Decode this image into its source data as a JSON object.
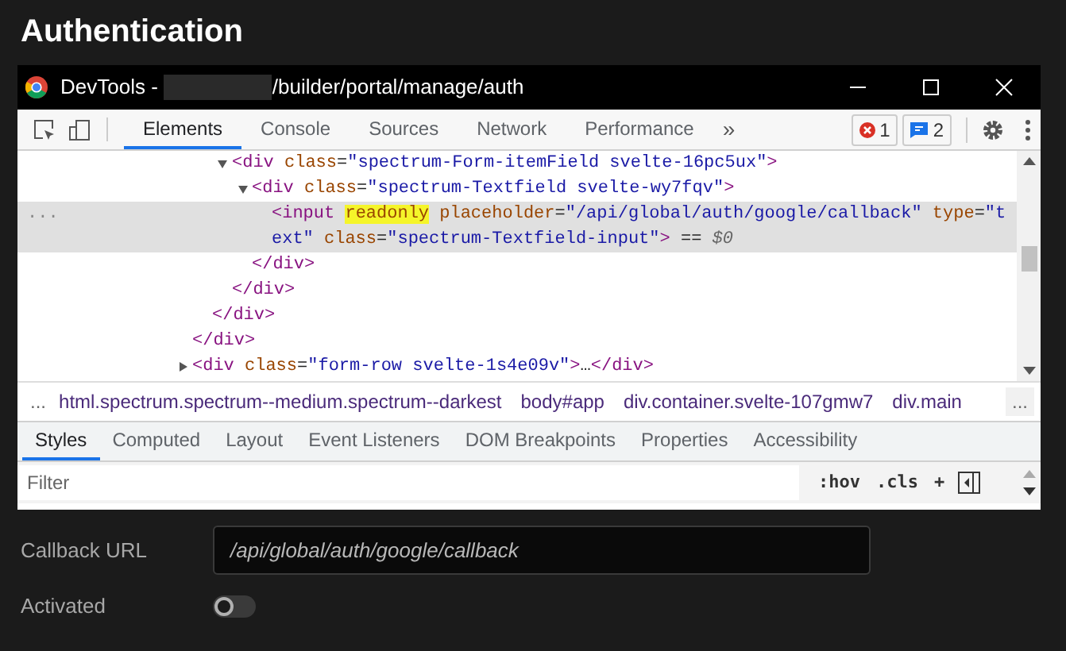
{
  "page": {
    "title": "Authentication"
  },
  "devtools": {
    "title_prefix": "DevTools -",
    "title_path": "/builder/portal/manage/auth",
    "tabs": [
      {
        "label": "Elements",
        "selected": true
      },
      {
        "label": "Console",
        "selected": false
      },
      {
        "label": "Sources",
        "selected": false
      },
      {
        "label": "Network",
        "selected": false
      },
      {
        "label": "Performance",
        "selected": false
      }
    ],
    "more_tabs": "»",
    "error_count": "1",
    "message_count": "2",
    "dom_tree": {
      "gutter_marker": "...",
      "nodes": [
        {
          "close": [
            {
              "kind": "tag",
              "text": "</div>"
            }
          ],
          "children": [
            {
              "close": [
                {
                  "kind": "tag",
                  "text": "</div>"
                }
              ],
              "children": [
                {
                  "open": [
                    {
                      "kind": "tag",
                      "text": "<div"
                    },
                    {
                      "kind": "attr",
                      "text": " class"
                    },
                    {
                      "kind": "plain",
                      "text": "="
                    },
                    {
                      "kind": "value",
                      "text": "\"spectrum-Form-itemField svelte-16pc5ux\""
                    },
                    {
                      "kind": "tag",
                      "text": ">"
                    }
                  ],
                  "expanded": true,
                  "close": [
                    {
                      "kind": "tag",
                      "text": "</div>"
                    }
                  ],
                  "children": [
                    {
                      "open": [
                        {
                          "kind": "tag",
                          "text": "<div"
                        },
                        {
                          "kind": "attr",
                          "text": " class"
                        },
                        {
                          "kind": "plain",
                          "text": "="
                        },
                        {
                          "kind": "value",
                          "text": "\"spectrum-Textfield svelte-wy7fqv\""
                        },
                        {
                          "kind": "tag",
                          "text": ">"
                        }
                      ],
                      "expanded": true,
                      "close": [
                        {
                          "kind": "tag",
                          "text": "</div>"
                        }
                      ],
                      "children": [
                        {
                          "open": [
                            {
                              "kind": "tag",
                              "text": "<input "
                            },
                            {
                              "kind": "match",
                              "text": "readonly"
                            },
                            {
                              "kind": "attr",
                              "text": " placeholder"
                            },
                            {
                              "kind": "plain",
                              "text": "="
                            },
                            {
                              "kind": "value",
                              "text": "\"/api/global/auth/google/callback\""
                            },
                            {
                              "kind": "attr",
                              "text": " type"
                            },
                            {
                              "kind": "plain",
                              "text": "="
                            },
                            {
                              "kind": "value",
                              "text": "\"text\""
                            },
                            {
                              "kind": "attr",
                              "text": " class"
                            },
                            {
                              "kind": "plain",
                              "text": "="
                            },
                            {
                              "kind": "value",
                              "text": "\"spectrum-Textfield-input\""
                            },
                            {
                              "kind": "tag",
                              "text": ">"
                            },
                            {
                              "kind": "plain",
                              "text": " == "
                            },
                            {
                              "kind": "ref",
                              "text": "$0"
                            }
                          ],
                          "selected": true
                        }
                      ]
                    }
                  ]
                }
              ]
            }
          ]
        },
        {
          "open": [
            {
              "kind": "tag",
              "text": "<div"
            },
            {
              "kind": "attr",
              "text": " class"
            },
            {
              "kind": "plain",
              "text": "="
            },
            {
              "kind": "value",
              "text": "\"form-row svelte-1s4e09v\""
            },
            {
              "kind": "tag",
              "text": ">"
            },
            {
              "kind": "plain",
              "text": "…"
            },
            {
              "kind": "tag",
              "text": "</div>"
            }
          ],
          "expanded": false
        }
      ]
    },
    "breadcrumbs": {
      "overflow_left": "...",
      "items": [
        "html.spectrum.spectrum--medium.spectrum--darkest",
        "body#app",
        "div.container.svelte-107gmw7",
        "div.main"
      ],
      "overflow_right": "..."
    },
    "style_tabs": [
      {
        "label": "Styles",
        "selected": true
      },
      {
        "label": "Computed",
        "selected": false
      },
      {
        "label": "Layout",
        "selected": false
      },
      {
        "label": "Event Listeners",
        "selected": false
      },
      {
        "label": "DOM Breakpoints",
        "selected": false
      },
      {
        "label": "Properties",
        "selected": false
      },
      {
        "label": "Accessibility",
        "selected": false
      }
    ],
    "filter": {
      "placeholder": "Filter"
    },
    "style_buttons": [
      ":hov",
      ".cls",
      "+"
    ]
  },
  "form": {
    "fields": [
      {
        "kind": "text",
        "label": "Callback URL",
        "placeholder": "/api/global/auth/google/callback"
      },
      {
        "kind": "toggle",
        "label": "Activated",
        "on": false
      }
    ]
  }
}
